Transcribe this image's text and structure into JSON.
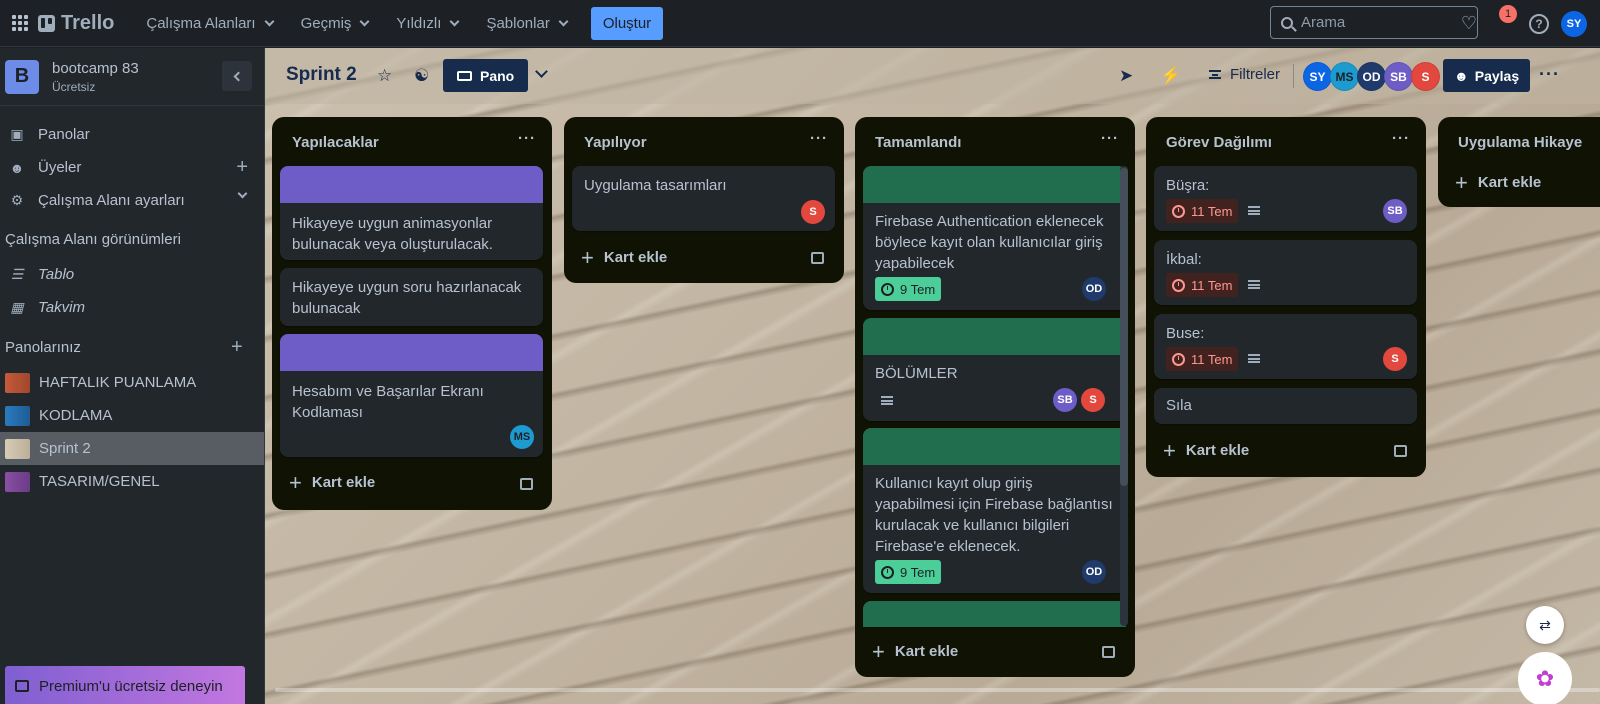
{
  "topbar": {
    "logo": "Trello",
    "nav": [
      {
        "label": "Çalışma Alanları"
      },
      {
        "label": "Geçmiş"
      },
      {
        "label": "Yıldızlı"
      },
      {
        "label": "Şablonlar"
      }
    ],
    "create_label": "Oluştur",
    "search_placeholder": "Arama",
    "notification_count": "1",
    "user_initials": "SY"
  },
  "sidebar": {
    "workspace_initial": "B",
    "workspace_name": "bootcamp 83",
    "workspace_plan": "Ücretsiz",
    "items": [
      {
        "label": "Panolar",
        "icon": "board-icon"
      },
      {
        "label": "Üyeler",
        "icon": "person-icon"
      },
      {
        "label": "Çalışma Alanı ayarları",
        "icon": "gear-icon"
      }
    ],
    "views_heading": "Çalışma Alanı görünümleri",
    "views": [
      {
        "label": "Tablo",
        "icon": "table-icon"
      },
      {
        "label": "Takvim",
        "icon": "calendar-icon"
      }
    ],
    "boards_heading": "Panolarınız",
    "boards": [
      {
        "label": "HAFTALIK PUANLAMA",
        "color": "#c55a3a"
      },
      {
        "label": "KODLAMA",
        "color": "#2a7bbf"
      },
      {
        "label": "Sprint 2",
        "color": "#d8ccb6"
      },
      {
        "label": "TASARIM/GENEL",
        "color": "#8a4fa3"
      }
    ],
    "premium_label": "Premium'u ücretsiz deneyin"
  },
  "board": {
    "title": "Sprint 2",
    "view_label": "Pano",
    "filter_label": "Filtreler",
    "share_label": "Paylaş",
    "members": [
      {
        "initials": "SY",
        "color": "#0c66e4"
      },
      {
        "initials": "MS",
        "color": "#1d9bd1"
      },
      {
        "initials": "OD",
        "color": "#1f3a6b"
      },
      {
        "initials": "SB",
        "color": "#6e5dc6"
      },
      {
        "initials": "S",
        "color": "#e2483d"
      }
    ]
  },
  "lists": [
    {
      "title": "Yapılacaklar",
      "add_label": "Kart ekle",
      "cards": [
        {
          "text": "Hikayeye uygun animasyonlar bulunacak veya oluşturulacak.",
          "cover": "#6e5dc6"
        },
        {
          "text": "Hikayeye uygun soru hazırlanacak bulunacak"
        },
        {
          "text": "Hesabım ve Başarılar Ekranı Kodlaması",
          "cover": "#6e5dc6",
          "member": "MS"
        }
      ]
    },
    {
      "title": "Yapılıyor",
      "add_label": "Kart ekle",
      "cards": [
        {
          "text": "Uygulama tasarımları",
          "member": "S"
        }
      ]
    },
    {
      "title": "Tamamlandı",
      "add_label": "Kart ekle",
      "cards": [
        {
          "text": "Firebase Authentication eklenecek böylece kayıt olan kullanıcılar giriş yapabilecek",
          "cover": "#216e4e",
          "date": "9 Tem",
          "member": "OD"
        },
        {
          "text": "BÖLÜMLER",
          "cover": "#216e4e",
          "members": [
            "SB",
            "S"
          ]
        },
        {
          "text": "Kullanıcı kayıt olup giriş yapabilmesi için Firebase bağlantısı kurulacak ve kullanıcı bilgileri Firebase'e eklenecek.",
          "cover": "#216e4e",
          "date": "9 Tem",
          "member": "OD"
        },
        {
          "text": "",
          "cover": "#216e4e"
        }
      ]
    },
    {
      "title": "Görev Dağılımı",
      "add_label": "Kart ekle",
      "cards": [
        {
          "text": "Büşra:",
          "date": "11 Tem",
          "member": "SB"
        },
        {
          "text": "İkbal:",
          "date": "11 Tem"
        },
        {
          "text": "Buse:",
          "date": "11 Tem",
          "member": "S"
        },
        {
          "text": "Sıla"
        }
      ]
    },
    {
      "title": "Uygulama Hikaye",
      "add_label": "Kart ekle",
      "cards": []
    }
  ]
}
